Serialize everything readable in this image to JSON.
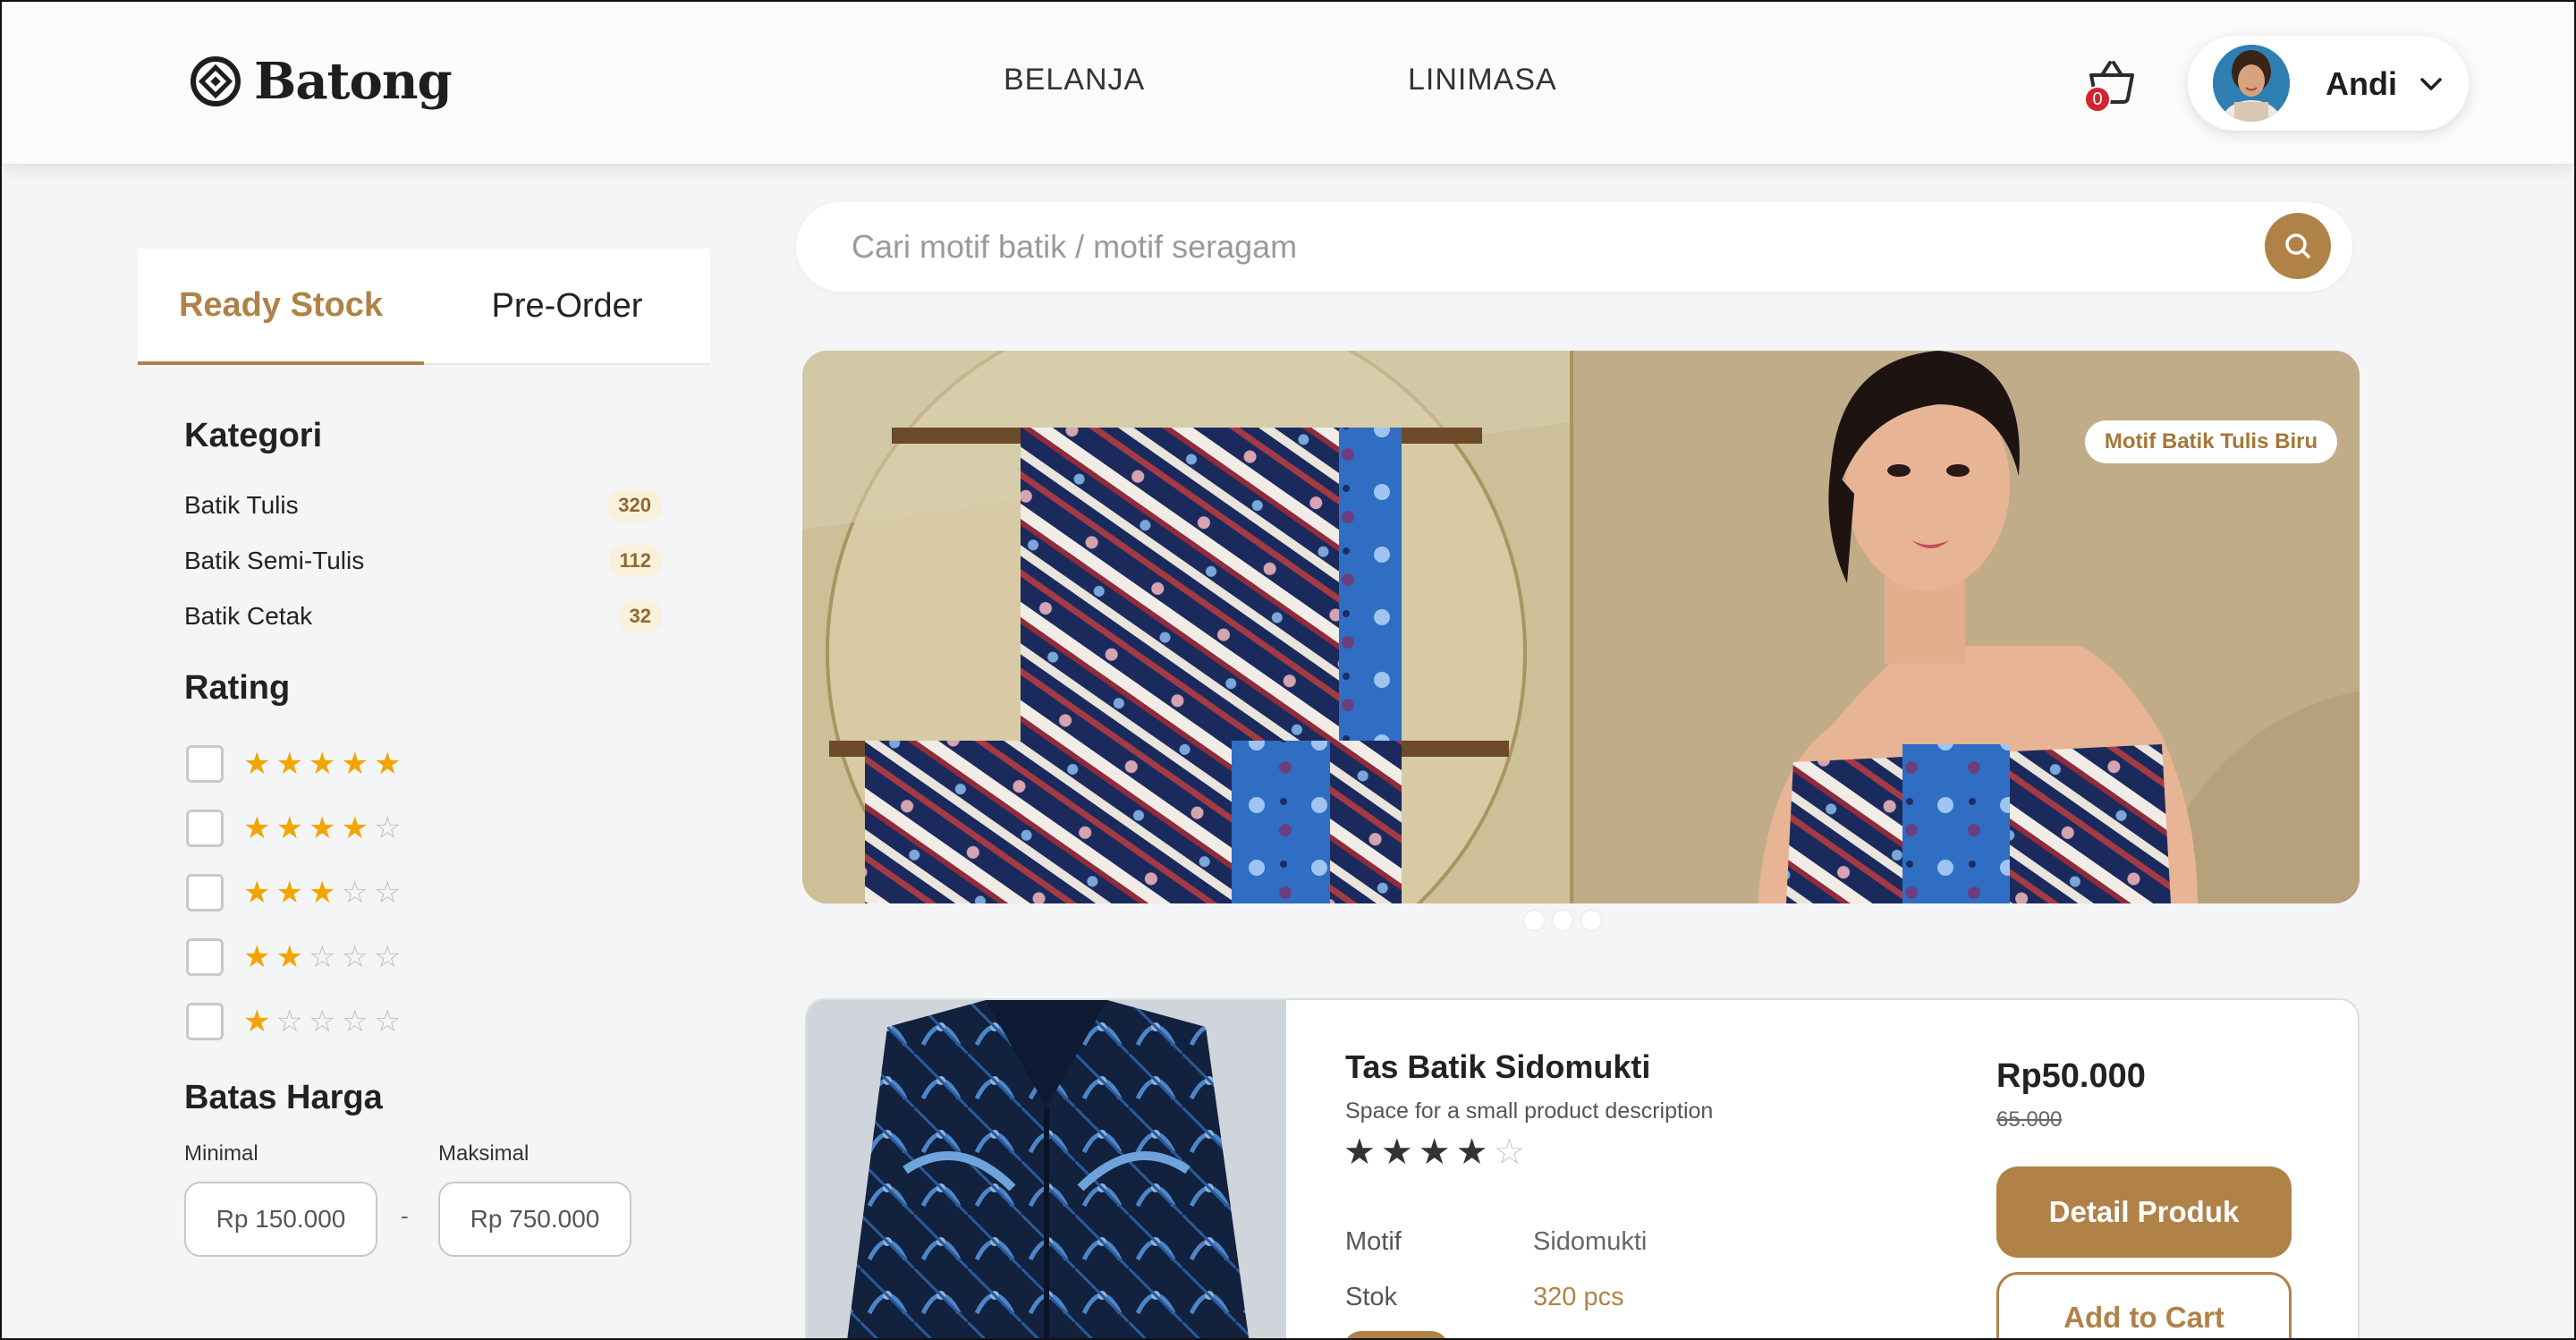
{
  "brand": {
    "name": "Batong"
  },
  "nav": {
    "items": [
      {
        "label": "BELANJA"
      },
      {
        "label": "LINIMASA"
      }
    ]
  },
  "cart": {
    "count": "0",
    "icon": "basket-icon"
  },
  "user": {
    "name": "Andi",
    "icon": "chevron-down-icon"
  },
  "sidebar": {
    "tabs": [
      {
        "label": "Ready Stock",
        "active": true
      },
      {
        "label": "Pre-Order",
        "active": false
      }
    ],
    "category_title": "Kategori",
    "categories": [
      {
        "label": "Batik Tulis",
        "count": "320"
      },
      {
        "label": "Batik Semi-Tulis",
        "count": "112"
      },
      {
        "label": "Batik Cetak",
        "count": "32"
      }
    ],
    "rating_title": "Rating",
    "ratings": [
      5,
      4,
      3,
      2,
      1
    ],
    "price_title": "Batas Harga",
    "price_min_label": "Minimal",
    "price_max_label": "Maksimal",
    "price_min_value": "Rp 150.000",
    "price_max_value": "Rp 750.000",
    "price_separator": "-"
  },
  "search": {
    "placeholder": "Cari motif batik / motif seragam",
    "icon": "search-icon"
  },
  "banner": {
    "tag": "Motif Batik Tulis Biru",
    "slides": 3,
    "active_slide": 0
  },
  "product": {
    "name": "Tas Batik Sidomukti",
    "description": "Space for a small product description",
    "rating": 4,
    "rating_max": 5,
    "spec_motif_label": "Motif",
    "spec_motif_value": "Sidomukti",
    "spec_stock_label": "Stok",
    "spec_stock_value": "320 pcs",
    "price": "Rp50.000",
    "old_price": "65.000",
    "detail_button": "Detail Produk",
    "cart_button": "Add to Cart"
  },
  "colors": {
    "accent": "#b08248",
    "star": "#f2a500",
    "badge": "#d3232f"
  }
}
